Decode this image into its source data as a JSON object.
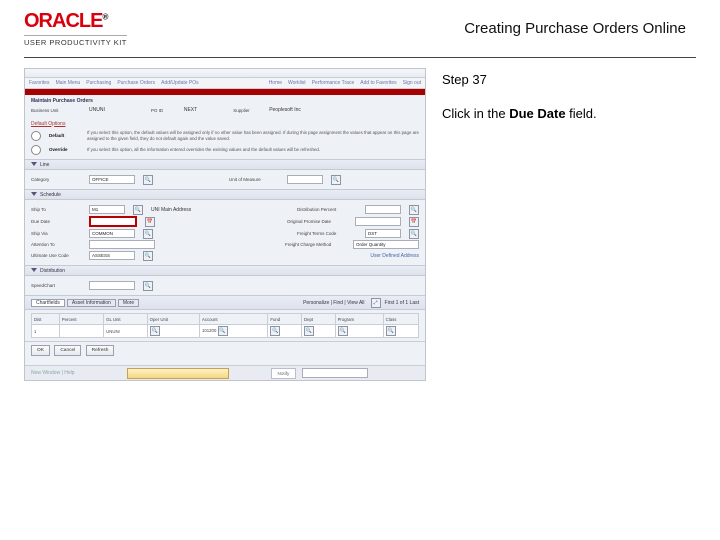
{
  "header": {
    "brand": "ORACLE",
    "subbrand": "USER PRODUCTIVITY KIT",
    "doc_title": "Creating Purchase Orders Online"
  },
  "instruction": {
    "step_label": "Step 37",
    "text_prefix": "Click in the ",
    "field_name": "Due Date",
    "text_suffix": " field."
  },
  "app": {
    "nav": {
      "t1": "Favorites",
      "t2": "Main Menu",
      "t3": "Purchasing",
      "t4": "Purchase Orders",
      "t5": "Add/Update POs",
      "r1": "Home",
      "r2": "Worklist",
      "r3": "Performance Trace",
      "r4": "Add to Favorites",
      "r5": "Sign out"
    },
    "page_title": "Maintain Purchase Orders",
    "top_fields": {
      "bu_label": "Business Unit",
      "bu_value": "UNUNI",
      "po_label": "PO ID",
      "po_value": "NEXT",
      "supplier_label": "Supplier",
      "supplier_value": "Peoplesoft Inc"
    },
    "defaults": {
      "title": "Default Options",
      "opt1_label": "Default",
      "opt1_text": "If you select this option, the default values will be assigned only if no other value has been assigned. If during this page assignment the values that appear on this page are assigned to the given field, they do not default again and the value saved.",
      "opt2_label": "Override",
      "opt2_text": "If you select this option, all the information entered overrides the existing values and the default values will be refreshed."
    },
    "line_section": {
      "title": "Line",
      "category_label": "Category",
      "category_value": "OFFICE",
      "uom_label": "Unit of Measure"
    },
    "schedule_section": {
      "title": "Schedule",
      "ship_to_label": "Ship To",
      "ship_to_value": "M1",
      "ship_to_desc": "UNI Main Address",
      "due_date_label": "Due Date",
      "ship_via_label": "Ship Via",
      "ship_via_value": "COMMON",
      "attention_to_label": "Attention To",
      "ultimate_use_label": "Ultimate Use Code",
      "ultimate_use_value": "ASSESS",
      "percent_label": "Distribution Percent",
      "origin_label": "Original Promise Date",
      "freight_label": "Freight Terms Code",
      "freight_value": "DST",
      "calc_label": "Freight Charge Method",
      "calc_value": "Order Quantity",
      "user_label": "User Defined Address"
    },
    "distribution_section": {
      "title": "Distribution",
      "speedchart_label": "SpeedChart"
    },
    "grid": {
      "tab1": "Chartfields",
      "tab2": "Asset Information",
      "tab3": "More",
      "finder_label": "Personalize | Find | View All",
      "range": "First 1 of 1 Last",
      "cols": {
        "dist": "Dist",
        "percent": "Percent",
        "gl_unit": "GL Unit",
        "oper": "Oper Unit",
        "account": "Account",
        "fund": "Fund",
        "dept": "Dept",
        "program": "Program",
        "class": "Class"
      },
      "row": {
        "dist": "1",
        "gl_unit": "UNUNI",
        "account": "101200"
      }
    },
    "buttons": {
      "ok": "OK",
      "cancel": "Cancel",
      "refresh": "Refresh"
    },
    "bottom": {
      "left": "New Window | Help",
      "right_label": "Notify"
    }
  }
}
